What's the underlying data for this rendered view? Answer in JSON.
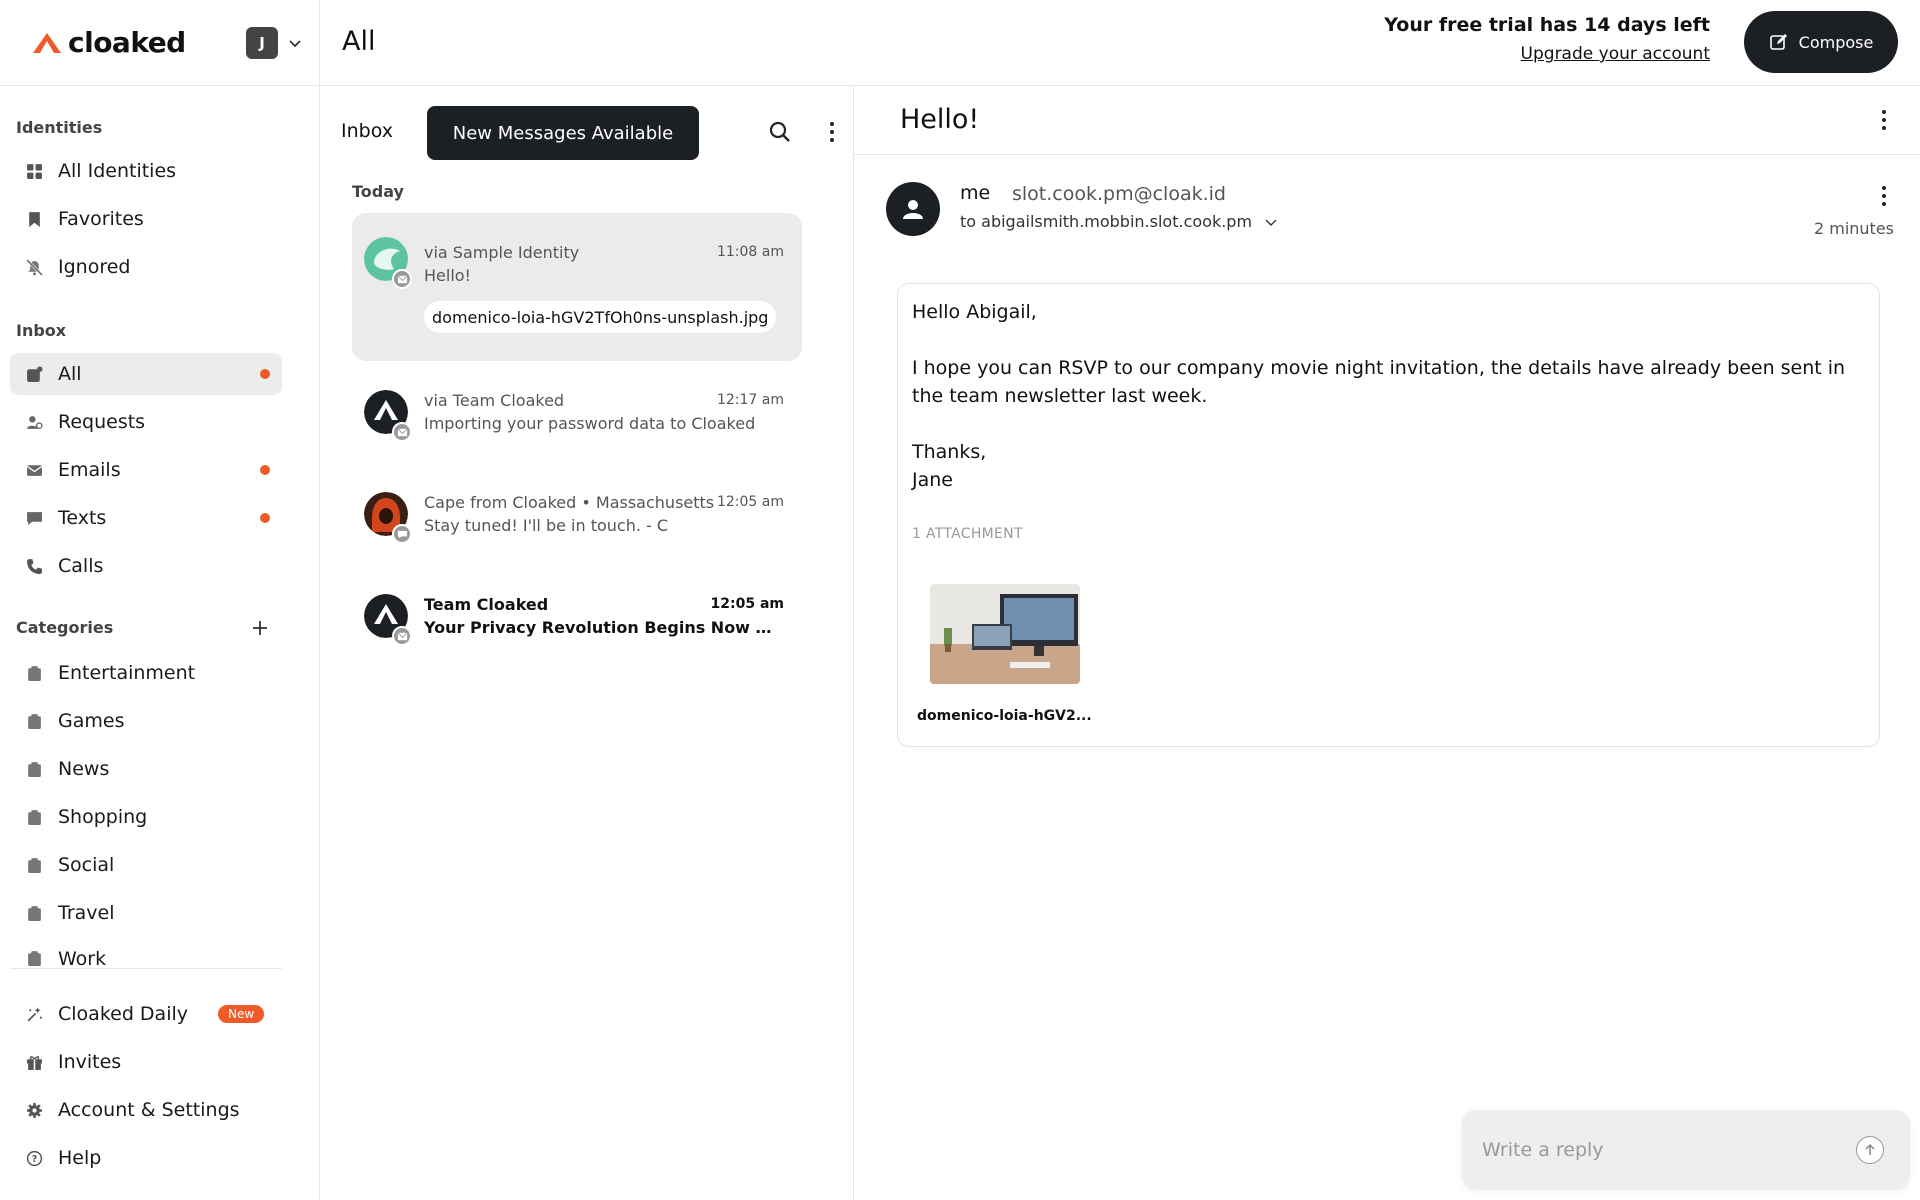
{
  "brand": {
    "name": "cloaked",
    "accent": "#f05a28",
    "account_initial": "J"
  },
  "sidebar": {
    "identities_label": "Identities",
    "identities": [
      {
        "label": "All Identities",
        "icon": "grid-icon"
      },
      {
        "label": "Favorites",
        "icon": "bookmark-icon"
      },
      {
        "label": "Ignored",
        "icon": "bell-off-icon"
      }
    ],
    "inbox_label": "Inbox",
    "inbox": [
      {
        "label": "All",
        "icon": "inbox-icon",
        "active": true,
        "unread_dot": true
      },
      {
        "label": "Requests",
        "icon": "requests-icon",
        "unread_dot": false
      },
      {
        "label": "Emails",
        "icon": "mail-icon",
        "unread_dot": true
      },
      {
        "label": "Texts",
        "icon": "chat-icon",
        "unread_dot": true
      },
      {
        "label": "Calls",
        "icon": "phone-icon",
        "unread_dot": false
      }
    ],
    "categories_label": "Categories",
    "categories": [
      "Entertainment",
      "Games",
      "News",
      "Shopping",
      "Social",
      "Travel",
      "Work"
    ],
    "footer": [
      {
        "label": "Cloaked Daily",
        "icon": "sparkle-icon",
        "badge": "New"
      },
      {
        "label": "Invites",
        "icon": "gift-icon"
      },
      {
        "label": "Account & Settings",
        "icon": "gear-icon"
      },
      {
        "label": "Help",
        "icon": "help-icon"
      }
    ]
  },
  "topbar": {
    "title": "All",
    "trial_text": "Your free trial has 14 days left",
    "upgrade_link": "Upgrade your account",
    "compose_label": "Compose"
  },
  "list": {
    "inbox_label": "Inbox",
    "new_messages_label": "New Messages Available",
    "today_label": "Today",
    "messages": [
      {
        "from": "via Sample Identity",
        "time": "11:08 am",
        "preview": "Hello!",
        "attachment": "domenico-loia-hGV2TfOh0ns-unsplash.jpg",
        "type": "email"
      },
      {
        "from": "via Team Cloaked",
        "time": "12:17 am",
        "preview": "Importing your password data to Cloaked",
        "type": "email"
      },
      {
        "from": "Cape from Cloaked • Massachusetts",
        "time": "12:05 am",
        "preview": "Stay tuned! I'll be in touch. - C",
        "type": "text"
      },
      {
        "from": "Team Cloaked",
        "time": "12:05 am",
        "preview": "Your Privacy Revolution Begins Now with...",
        "type": "email",
        "unread": true
      }
    ]
  },
  "reader": {
    "subject": "Hello!",
    "sender_name": "me",
    "sender_email": "slot.cook.pm@cloak.id",
    "recipient": "to abigailsmith.mobbin.slot.cook.pm",
    "time_ago": "2 minutes",
    "body": [
      "Hello Abigail,",
      "I hope you can RSVP to our company movie night invitation, the details have already been sent in the team newsletter last week.",
      "Thanks,\nJane"
    ],
    "body_greeting": "Hello Abigail,",
    "body_main": "I hope you can RSVP to our company movie night invitation, the details have already been sent in the team newsletter last week.",
    "body_signoff": "Thanks,",
    "body_signature": "Jane",
    "attachments_label": "1 ATTACHMENT",
    "attachment_name": "domenico-loia-hGV2...",
    "reply_placeholder": "Write a reply"
  }
}
